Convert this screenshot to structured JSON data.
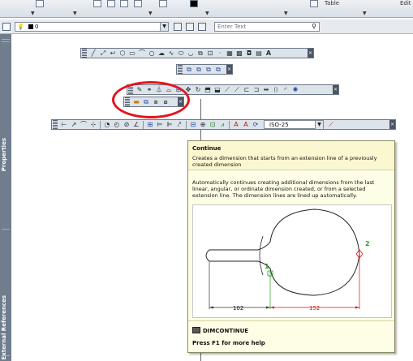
{
  "ribbon": {
    "panel_labels": [
      "Table",
      "Edit"
    ]
  },
  "layer_bar": {
    "layer_value": "0",
    "search_placeholder": "Enter Text"
  },
  "palette": {
    "labels": [
      "Properties",
      "External References"
    ]
  },
  "toolbars": {
    "dimension": {
      "style_value": "ISO-25"
    }
  },
  "tooltip": {
    "title": "Continue",
    "description": "Creates a dimension that starts from an extension line of a previously created dimension",
    "body": "Automatically continues creating additional dimensions from the last linear, angular, or ordinate dimension created, or from a selected extension line. The dimension lines are lined up automatically.",
    "illustration": {
      "dim_left": "102",
      "dim_right": "152",
      "marker_1": "1",
      "marker_2": "2"
    },
    "command": "DIMCONTINUE",
    "help": "Press F1 for more help"
  },
  "colors": {
    "highlight": "#e4141c",
    "tooltip_bg": "#fefee6",
    "palette_bg": "#6f7d8d"
  }
}
